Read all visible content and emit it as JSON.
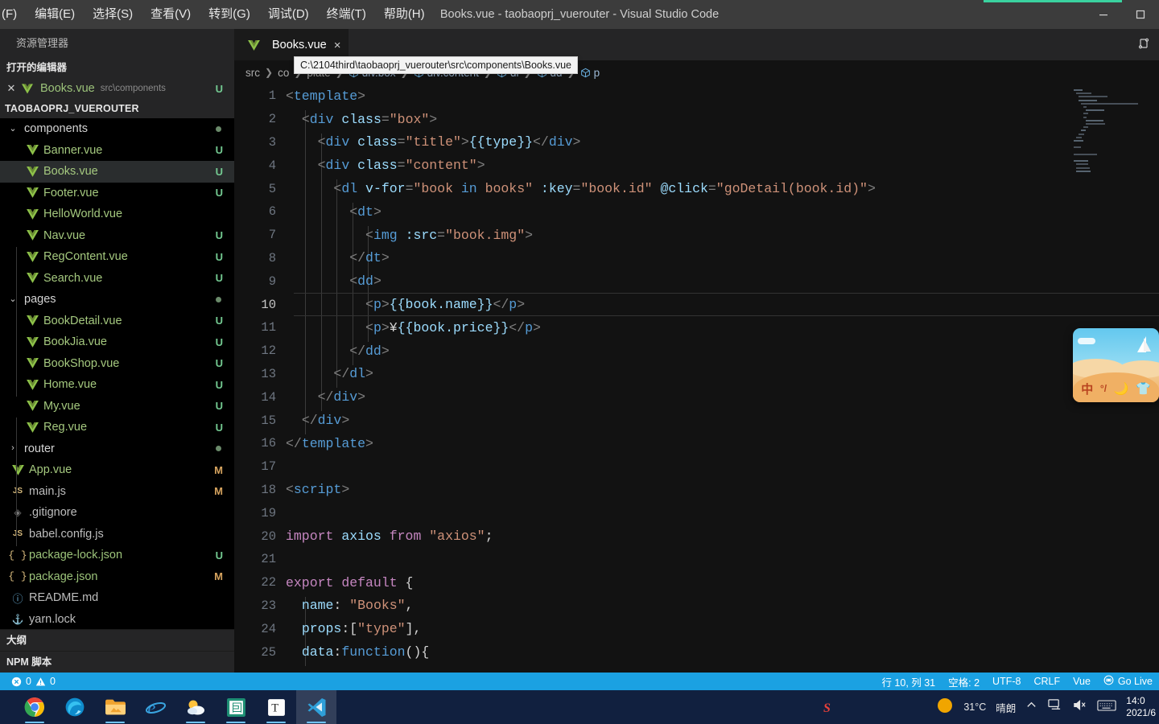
{
  "titlebar": {
    "menu": [
      "(F)",
      "编辑(E)",
      "选择(S)",
      "查看(V)",
      "转到(G)",
      "调试(D)",
      "终端(T)",
      "帮助(H)"
    ],
    "window_title": "Books.vue - taobaoprj_vuerouter - Visual Studio Code",
    "minimize": "minimize-icon",
    "maximize": "maximize-icon"
  },
  "sidebar": {
    "panel_title": "资源管理器",
    "open_editors_title": "打开的编辑器",
    "open_editor": {
      "name": "Books.vue",
      "path": "src\\components",
      "badge": "U"
    },
    "project_name": "TAOBAOPRJ_VUEROUTER",
    "tree": [
      {
        "label": "components",
        "kind": "folder",
        "expanded": true,
        "indent": 0,
        "badge": "dot"
      },
      {
        "label": "Banner.vue",
        "kind": "vue",
        "indent": 1,
        "badge": "U"
      },
      {
        "label": "Books.vue",
        "kind": "vue",
        "indent": 1,
        "badge": "U",
        "selected": true
      },
      {
        "label": "Footer.vue",
        "kind": "vue",
        "indent": 1,
        "badge": "U"
      },
      {
        "label": "HelloWorld.vue",
        "kind": "vue",
        "indent": 1,
        "badge": ""
      },
      {
        "label": "Nav.vue",
        "kind": "vue",
        "indent": 1,
        "badge": "U"
      },
      {
        "label": "RegContent.vue",
        "kind": "vue",
        "indent": 1,
        "badge": "U"
      },
      {
        "label": "Search.vue",
        "kind": "vue",
        "indent": 1,
        "badge": "U"
      },
      {
        "label": "pages",
        "kind": "folder",
        "expanded": true,
        "indent": 0,
        "badge": "dot"
      },
      {
        "label": "BookDetail.vue",
        "kind": "vue",
        "indent": 1,
        "badge": "U"
      },
      {
        "label": "BookJia.vue",
        "kind": "vue",
        "indent": 1,
        "badge": "U"
      },
      {
        "label": "BookShop.vue",
        "kind": "vue",
        "indent": 1,
        "badge": "U"
      },
      {
        "label": "Home.vue",
        "kind": "vue",
        "indent": 1,
        "badge": "U"
      },
      {
        "label": "My.vue",
        "kind": "vue",
        "indent": 1,
        "badge": "U"
      },
      {
        "label": "Reg.vue",
        "kind": "vue",
        "indent": 1,
        "badge": "U"
      },
      {
        "label": "router",
        "kind": "folder",
        "expanded": false,
        "indent": 0,
        "badge": "dot"
      },
      {
        "label": "App.vue",
        "kind": "vue",
        "indent": 0,
        "badge": "M"
      },
      {
        "label": "main.js",
        "kind": "js",
        "indent": 0,
        "badge": "M"
      },
      {
        "label": ".gitignore",
        "kind": "git",
        "indent": 0,
        "badge": ""
      },
      {
        "label": "babel.config.js",
        "kind": "js",
        "indent": 0,
        "badge": ""
      },
      {
        "label": "package-lock.json",
        "kind": "json",
        "indent": 0,
        "badge": "U"
      },
      {
        "label": "package.json",
        "kind": "json",
        "indent": 0,
        "badge": "M"
      },
      {
        "label": "README.md",
        "kind": "md",
        "indent": 0,
        "badge": ""
      },
      {
        "label": "yarn.lock",
        "kind": "lock",
        "indent": 0,
        "badge": ""
      }
    ],
    "outline_title": "大纲",
    "npm_title": "NPM 脚本"
  },
  "editor": {
    "tab": {
      "label": "Books.vue",
      "close": "×",
      "icon": "vue-icon"
    },
    "split_icon": "split-editor-icon",
    "breadcrumb": [
      "src",
      "co",
      "mponents",
      "Books.vue",
      "template",
      "div.box",
      "div.content",
      "dl",
      "dd",
      "p"
    ],
    "breadcrumb_visible": [
      "src",
      "co",
      "plate",
      "div.box",
      "div.content",
      "dl",
      "dd",
      "p"
    ],
    "tooltip": "C:\\2104third\\taobaoprj_vuerouter\\src\\components\\Books.vue",
    "current_line": 10,
    "lines": [
      {
        "n": 1,
        "indent": 0,
        "tokens": [
          [
            "t-punct",
            "<"
          ],
          [
            "t-tag",
            "template"
          ],
          [
            "t-punct",
            ">"
          ]
        ]
      },
      {
        "n": 2,
        "indent": 1,
        "tokens": [
          [
            "t-punct",
            "<"
          ],
          [
            "t-tag",
            "div"
          ],
          [
            "t-plain",
            " "
          ],
          [
            "t-attr",
            "class"
          ],
          [
            "t-punct",
            "="
          ],
          [
            "t-str",
            "\"box\""
          ],
          [
            "t-punct",
            ">"
          ]
        ]
      },
      {
        "n": 3,
        "indent": 2,
        "tokens": [
          [
            "t-punct",
            "<"
          ],
          [
            "t-tag",
            "div"
          ],
          [
            "t-plain",
            " "
          ],
          [
            "t-attr",
            "class"
          ],
          [
            "t-punct",
            "="
          ],
          [
            "t-str",
            "\"title\""
          ],
          [
            "t-punct",
            ">"
          ],
          [
            "t-mus",
            "{{type}}"
          ],
          [
            "t-punct",
            "</"
          ],
          [
            "t-tag",
            "div"
          ],
          [
            "t-punct",
            ">"
          ]
        ]
      },
      {
        "n": 4,
        "indent": 2,
        "tokens": [
          [
            "t-punct",
            "<"
          ],
          [
            "t-tag",
            "div"
          ],
          [
            "t-plain",
            " "
          ],
          [
            "t-attr",
            "class"
          ],
          [
            "t-punct",
            "="
          ],
          [
            "t-str",
            "\"content\""
          ],
          [
            "t-punct",
            ">"
          ]
        ]
      },
      {
        "n": 5,
        "indent": 3,
        "tokens": [
          [
            "t-punct",
            "<"
          ],
          [
            "t-tag",
            "dl"
          ],
          [
            "t-plain",
            " "
          ],
          [
            "t-attr",
            "v-for"
          ],
          [
            "t-punct",
            "="
          ],
          [
            "t-str",
            "\"book "
          ],
          [
            "t-kw2",
            "in"
          ],
          [
            "t-str",
            " books\""
          ],
          [
            "t-plain",
            " "
          ],
          [
            "t-attr",
            ":key"
          ],
          [
            "t-punct",
            "="
          ],
          [
            "t-str",
            "\"book.id\""
          ],
          [
            "t-plain",
            " "
          ],
          [
            "t-attr",
            "@click"
          ],
          [
            "t-punct",
            "="
          ],
          [
            "t-str",
            "\"goDetail(book.id)\""
          ],
          [
            "t-punct",
            ">"
          ]
        ]
      },
      {
        "n": 6,
        "indent": 4,
        "tokens": [
          [
            "t-punct",
            "<"
          ],
          [
            "t-tag",
            "dt"
          ],
          [
            "t-punct",
            ">"
          ]
        ]
      },
      {
        "n": 7,
        "indent": 5,
        "tokens": [
          [
            "t-punct",
            "<"
          ],
          [
            "t-tag",
            "img"
          ],
          [
            "t-plain",
            " "
          ],
          [
            "t-attr",
            ":src"
          ],
          [
            "t-punct",
            "="
          ],
          [
            "t-str",
            "\"book.img\""
          ],
          [
            "t-punct",
            ">"
          ]
        ]
      },
      {
        "n": 8,
        "indent": 4,
        "tokens": [
          [
            "t-punct",
            "</"
          ],
          [
            "t-tag",
            "dt"
          ],
          [
            "t-punct",
            ">"
          ]
        ]
      },
      {
        "n": 9,
        "indent": 4,
        "tokens": [
          [
            "t-punct",
            "<"
          ],
          [
            "t-tag",
            "dd"
          ],
          [
            "t-punct",
            ">"
          ]
        ]
      },
      {
        "n": 10,
        "indent": 5,
        "tokens": [
          [
            "t-punct",
            "<"
          ],
          [
            "t-tag",
            "p"
          ],
          [
            "t-punct",
            ">"
          ],
          [
            "t-mus",
            "{{book.name}}"
          ],
          [
            "t-punct",
            "</"
          ],
          [
            "t-tag",
            "p"
          ],
          [
            "t-punct",
            ">"
          ]
        ]
      },
      {
        "n": 11,
        "indent": 5,
        "tokens": [
          [
            "t-punct",
            "<"
          ],
          [
            "t-tag",
            "p"
          ],
          [
            "t-punct",
            ">"
          ],
          [
            "t-plain",
            "¥"
          ],
          [
            "t-mus",
            "{{book.price}}"
          ],
          [
            "t-punct",
            "</"
          ],
          [
            "t-tag",
            "p"
          ],
          [
            "t-punct",
            ">"
          ]
        ]
      },
      {
        "n": 12,
        "indent": 4,
        "tokens": [
          [
            "t-punct",
            "</"
          ],
          [
            "t-tag",
            "dd"
          ],
          [
            "t-punct",
            ">"
          ]
        ]
      },
      {
        "n": 13,
        "indent": 3,
        "tokens": [
          [
            "t-punct",
            "</"
          ],
          [
            "t-tag",
            "dl"
          ],
          [
            "t-punct",
            ">"
          ]
        ]
      },
      {
        "n": 14,
        "indent": 2,
        "tokens": [
          [
            "t-punct",
            "</"
          ],
          [
            "t-tag",
            "div"
          ],
          [
            "t-punct",
            ">"
          ]
        ]
      },
      {
        "n": 15,
        "indent": 1,
        "tokens": [
          [
            "t-punct",
            "</"
          ],
          [
            "t-tag",
            "div"
          ],
          [
            "t-punct",
            ">"
          ]
        ]
      },
      {
        "n": 16,
        "indent": 0,
        "tokens": [
          [
            "t-punct",
            "</"
          ],
          [
            "t-tag",
            "template"
          ],
          [
            "t-punct",
            ">"
          ]
        ]
      },
      {
        "n": 17,
        "indent": 0,
        "tokens": []
      },
      {
        "n": 18,
        "indent": 0,
        "tokens": [
          [
            "t-punct",
            "<"
          ],
          [
            "t-tag",
            "script"
          ],
          [
            "t-punct",
            ">"
          ]
        ]
      },
      {
        "n": 19,
        "indent": 0,
        "tokens": []
      },
      {
        "n": 20,
        "indent": 0,
        "tokens": [
          [
            "t-kw",
            "import"
          ],
          [
            "t-plain",
            " "
          ],
          [
            "t-id",
            "axios"
          ],
          [
            "t-plain",
            " "
          ],
          [
            "t-kw",
            "from"
          ],
          [
            "t-plain",
            " "
          ],
          [
            "t-str",
            "\"axios\""
          ],
          [
            "t-plain",
            ";"
          ]
        ]
      },
      {
        "n": 21,
        "indent": 0,
        "tokens": []
      },
      {
        "n": 22,
        "indent": 0,
        "tokens": [
          [
            "t-kw",
            "export"
          ],
          [
            "t-plain",
            " "
          ],
          [
            "t-kw",
            "default"
          ],
          [
            "t-plain",
            " {"
          ]
        ]
      },
      {
        "n": 23,
        "indent": 1,
        "tokens": [
          [
            "t-prop",
            "name"
          ],
          [
            "t-plain",
            ": "
          ],
          [
            "t-str",
            "\"Books\""
          ],
          [
            "t-plain",
            ","
          ]
        ]
      },
      {
        "n": 24,
        "indent": 1,
        "tokens": [
          [
            "t-prop",
            "props"
          ],
          [
            "t-plain",
            ":["
          ],
          [
            "t-str",
            "\"type\""
          ],
          [
            "t-plain",
            "],"
          ]
        ]
      },
      {
        "n": 25,
        "indent": 1,
        "tokens": [
          [
            "t-prop",
            "data"
          ],
          [
            "t-plain",
            ":"
          ],
          [
            "t-kw2",
            "function"
          ],
          [
            "t-plain",
            "(){"
          ]
        ]
      }
    ]
  },
  "statusbar": {
    "errors": "0",
    "warnings": "0",
    "cursor": "行 10, 列 31",
    "spaces": "空格: 2",
    "encoding": "UTF-8",
    "eol": "CRLF",
    "language": "Vue",
    "golive": "Go Live",
    "golive_icon": "broadcast-icon"
  },
  "taskbar": {
    "apps": [
      {
        "name": "chrome",
        "running": true
      },
      {
        "name": "edge",
        "running": false
      },
      {
        "name": "file-explorer",
        "running": true
      },
      {
        "name": "internet-explorer",
        "running": false
      },
      {
        "name": "weather",
        "running": true
      },
      {
        "name": "wps-writer",
        "running": true
      },
      {
        "name": "typora",
        "running": true
      },
      {
        "name": "visual-studio-code",
        "running": true,
        "active": true
      }
    ],
    "sogou_icon": "sogou-ime-icon",
    "weather_temp": "31°C",
    "weather_desc": "晴朗",
    "tray": [
      "chevron-up-icon",
      "network-icon",
      "volume-muted-icon",
      "keyboard-icon"
    ],
    "clock_time": "14:0",
    "clock_date": "2021/6"
  },
  "ime_widget": {
    "items": [
      "中",
      "°/",
      "☽",
      "shirt"
    ],
    "label": "sogou-ime-floating-bar"
  }
}
